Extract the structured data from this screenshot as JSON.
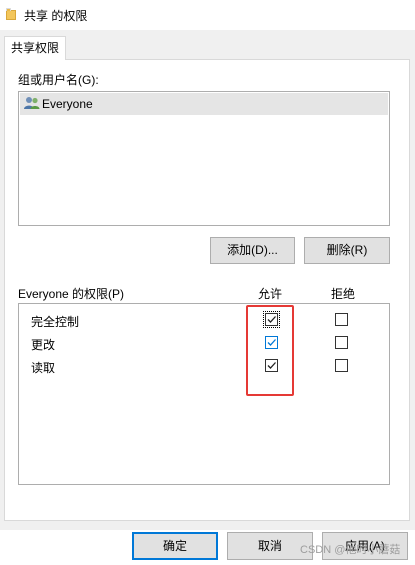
{
  "window": {
    "title": "共享 的权限",
    "folder_icon": "folder-icon"
  },
  "tabs": [
    {
      "label": "共享权限",
      "selected": true
    }
  ],
  "groups": {
    "label": "组或用户名(G):",
    "users": [
      {
        "name": "Everyone",
        "icon": "users-icon",
        "selected": true
      }
    ],
    "add_button": "添加(D)...",
    "remove_button": "删除(R)"
  },
  "permissions": {
    "label": "Everyone 的权限(P)",
    "allow_header": "允许",
    "deny_header": "拒绝",
    "rows": [
      {
        "name": "完全控制",
        "allow": true,
        "deny": false
      },
      {
        "name": "更改",
        "allow": true,
        "deny": false
      },
      {
        "name": "读取",
        "allow": true,
        "deny": false
      }
    ]
  },
  "footer": {
    "ok": "确定",
    "cancel": "取消",
    "apply": "应用(A)"
  },
  "watermark": "CSDN @他时小蘑菇",
  "colors": {
    "accent": "#0078d7",
    "highlight_red": "#e53935",
    "button_face": "#e1e1e1"
  }
}
